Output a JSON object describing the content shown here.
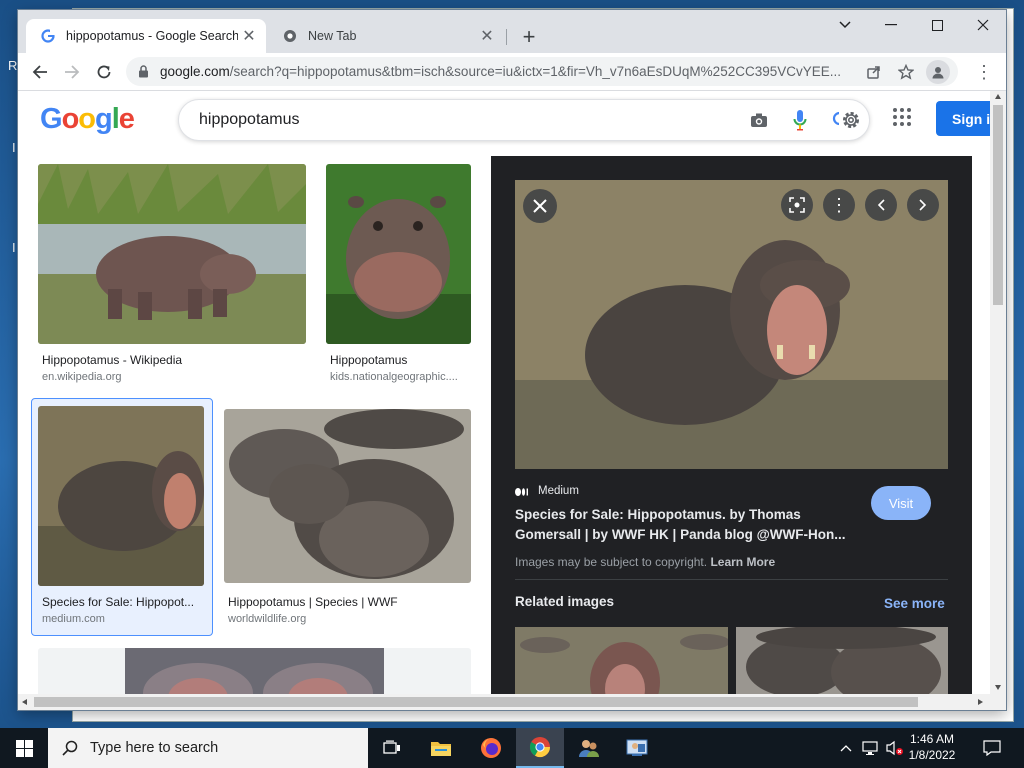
{
  "browser": {
    "tabs": [
      {
        "title": "hippopotamus - Google Search",
        "active": true
      },
      {
        "title": "New Tab",
        "active": false
      }
    ],
    "url_host": "google.com",
    "url_rest": "/search?q=hippopotamus&tbm=isch&source=iu&ictx=1&fir=Vh_v7n6aEsDUqM%252CC395VCvYEE...",
    "new_tab_symbol": "+"
  },
  "google": {
    "logo_letters": [
      "G",
      "o",
      "o",
      "g",
      "l",
      "e"
    ],
    "query": "hippopotamus",
    "sign_in_label": "Sign in"
  },
  "results": [
    {
      "caption": "Hippopotamus - Wikipedia",
      "source": "en.wikipedia.org"
    },
    {
      "caption": "Hippopotamus",
      "source": "kids.nationalgeographic...."
    },
    {
      "caption": "Species for Sale: Hippopot...",
      "source": "medium.com"
    },
    {
      "caption": "Hippopotamus | Species | WWF",
      "source": "worldwildlife.org"
    }
  ],
  "preview": {
    "site_name": "Medium",
    "title_line1": "Species for Sale: Hippopotamus. by Thomas",
    "title_line2": "Gomersall | by WWF HK | Panda blog @WWF-Hon...",
    "visit_label": "Visit",
    "copyright_text": "Images may be subject to copyright.",
    "learn_more": "Learn More",
    "related_heading": "Related images",
    "see_more": "See more"
  },
  "taskbar": {
    "search_placeholder": "Type here to search",
    "time": "1:46 AM",
    "date": "1/8/2022"
  },
  "colors": {
    "google_blue": "#4285f4",
    "google_red": "#ea4335",
    "google_yellow": "#fbbc05",
    "google_green": "#34a853",
    "sign_in_bg": "#1a73e8",
    "panel_bg": "#202124",
    "link_blue": "#8ab4f8"
  }
}
